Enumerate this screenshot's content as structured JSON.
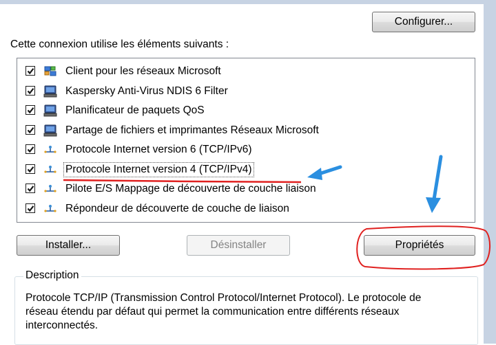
{
  "buttons": {
    "configure": "Configurer...",
    "install": "Installer...",
    "uninstall": "Désinstaller",
    "properties": "Propriétés"
  },
  "intro_text": "Cette connexion utilise les éléments suivants :",
  "components": [
    {
      "label": "Client pour les réseaux Microsoft",
      "checked": true,
      "icon": "network-client-icon"
    },
    {
      "label": "Kaspersky Anti-Virus NDIS 6 Filter",
      "checked": true,
      "icon": "computer-service-icon"
    },
    {
      "label": "Planificateur de paquets QoS",
      "checked": true,
      "icon": "computer-service-icon"
    },
    {
      "label": "Partage de fichiers et imprimantes Réseaux Microsoft",
      "checked": true,
      "icon": "computer-service-icon"
    },
    {
      "label": "Protocole Internet version 6 (TCP/IPv6)",
      "checked": true,
      "icon": "protocol-icon"
    },
    {
      "label": "Protocole Internet version 4 (TCP/IPv4)",
      "checked": true,
      "icon": "protocol-icon",
      "selected": true
    },
    {
      "label": "Pilote E/S Mappage de découverte de couche liaison",
      "checked": true,
      "icon": "protocol-icon"
    },
    {
      "label": "Répondeur de découverte de couche de liaison",
      "checked": true,
      "icon": "protocol-icon"
    }
  ],
  "description": {
    "legend": "Description",
    "text": "Protocole TCP/IP (Transmission Control Protocol/Internet Protocol). Le protocole de réseau étendu par défaut qui permet la communication entre différents réseaux interconnectés."
  },
  "annotation_colors": {
    "arrow": "#2b8fe0",
    "highlight": "#e0201f"
  }
}
